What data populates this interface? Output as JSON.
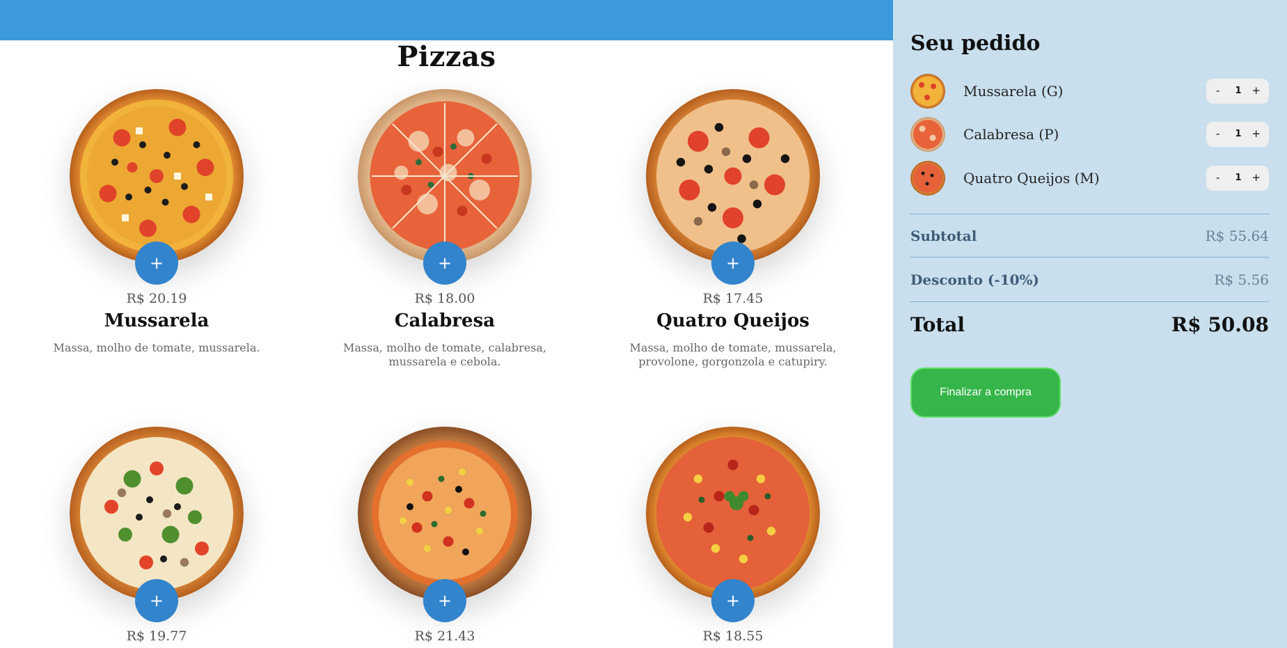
{
  "menu": {
    "section_title": "Pizzas",
    "pizzas": [
      {
        "price": "R$ 20.19",
        "name": "Mussarela",
        "description": "Massa, molho de tomate, mussarela.",
        "add_label": "+"
      },
      {
        "price": "R$ 18.00",
        "name": "Calabresa",
        "description": "Massa, molho de tomate, calabresa, mussarela e cebola.",
        "add_label": "+"
      },
      {
        "price": "R$ 17.45",
        "name": "Quatro Queijos",
        "description": "Massa, molho de tomate, mussarela, provolone, gorgonzola e catupiry.",
        "add_label": "+"
      },
      {
        "price": "R$ 19.77",
        "name": "",
        "description": "",
        "add_label": "+"
      },
      {
        "price": "R$ 21.43",
        "name": "",
        "description": "",
        "add_label": "+"
      },
      {
        "price": "R$ 18.55",
        "name": "",
        "description": "",
        "add_label": "+"
      }
    ]
  },
  "cart": {
    "title": "Seu pedido",
    "items": [
      {
        "name": "Mussarela (G)",
        "qty": "1",
        "minus": "-",
        "plus": "+"
      },
      {
        "name": "Calabresa (P)",
        "qty": "1",
        "minus": "-",
        "plus": "+"
      },
      {
        "name": "Quatro Queijos (M)",
        "qty": "1",
        "minus": "-",
        "plus": "+"
      }
    ],
    "subtotal_label": "Subtotal",
    "subtotal_value": "R$ 55.64",
    "discount_label": "Desconto (-10%)",
    "discount_value": "R$ 5.56",
    "total_label": "Total",
    "total_value": "R$ 50.08",
    "checkout_label": "Finalizar a compra"
  },
  "colors": {
    "header": "#3b99dc",
    "sidebar": "#c9dfee",
    "add_button": "#3284cc",
    "checkout": "#36b54a"
  }
}
